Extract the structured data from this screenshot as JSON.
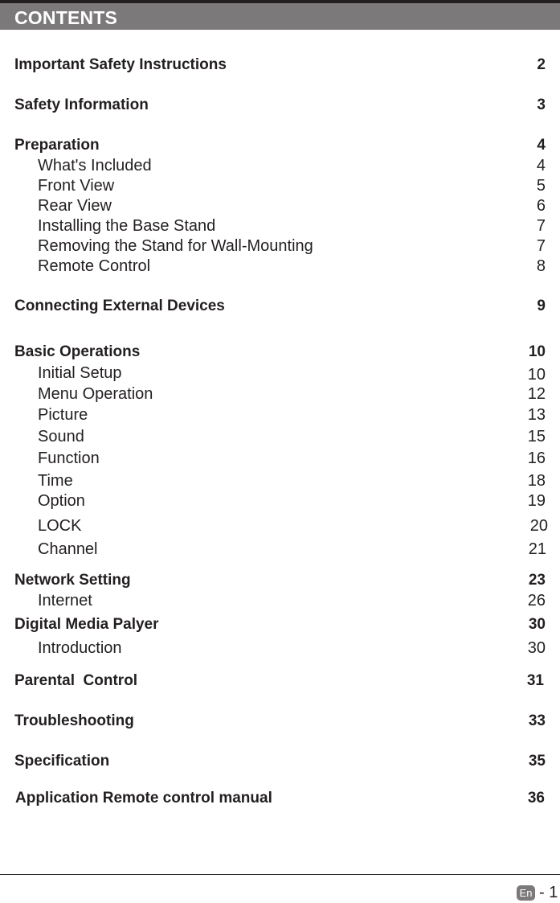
{
  "header": {
    "title": "CONTENTS"
  },
  "toc": [
    {
      "label": "Important Safety Instructions",
      "page": "2",
      "level": "main"
    },
    {
      "label": "Safety Information",
      "page": "3",
      "level": "main"
    },
    {
      "label": "Preparation",
      "page": "4",
      "level": "main"
    },
    {
      "label": "What's Included",
      "page": "4",
      "level": "sub"
    },
    {
      "label": "Front View",
      "page": "5",
      "level": "sub"
    },
    {
      "label": "Rear View",
      "page": "6",
      "level": "sub"
    },
    {
      "label": "Installing the Base Stand",
      "page": "7",
      "level": "sub"
    },
    {
      "label": "Removing the Stand for Wall-Mounting",
      "page": "7",
      "level": "sub"
    },
    {
      "label": "Remote Control",
      "page": "8",
      "level": "sub"
    },
    {
      "label": "Connecting External Devices",
      "page": "9",
      "level": "main"
    },
    {
      "label": "Basic Operations",
      "page": "10",
      "level": "main"
    },
    {
      "label": "Initial Setup",
      "page": "10",
      "level": "sub"
    },
    {
      "label": "Menu Operation",
      "page": "12",
      "level": "sub"
    },
    {
      "label": "Picture",
      "page": "13",
      "level": "sub"
    },
    {
      "label": "Sound",
      "page": "15",
      "level": "sub"
    },
    {
      "label": "Function",
      "page": "16",
      "level": "sub"
    },
    {
      "label": "Time",
      "page": "18",
      "level": "sub"
    },
    {
      "label": "Option",
      "page": "19",
      "level": "sub"
    },
    {
      "label": "LOCK",
      "page": "20",
      "level": "sub"
    },
    {
      "label": "Channel",
      "page": "21",
      "level": "sub"
    },
    {
      "label": "Network Setting",
      "page": "23",
      "level": "main"
    },
    {
      "label": "Internet",
      "page": "26",
      "level": "sub"
    },
    {
      "label": "Digital Media Palyer",
      "page": "30",
      "level": "main"
    },
    {
      "label": "Introduction",
      "page": "30",
      "level": "sub"
    },
    {
      "label": "Parental  Control",
      "page": "31",
      "level": "main"
    },
    {
      "label": "Troubleshooting",
      "page": "33",
      "level": "main"
    },
    {
      "label": "Specification",
      "page": "35",
      "level": "main"
    },
    {
      "label": "Application Remote control manual",
      "page": "36",
      "level": "main"
    }
  ],
  "footer": {
    "language": "En",
    "page_label": "- 1"
  }
}
